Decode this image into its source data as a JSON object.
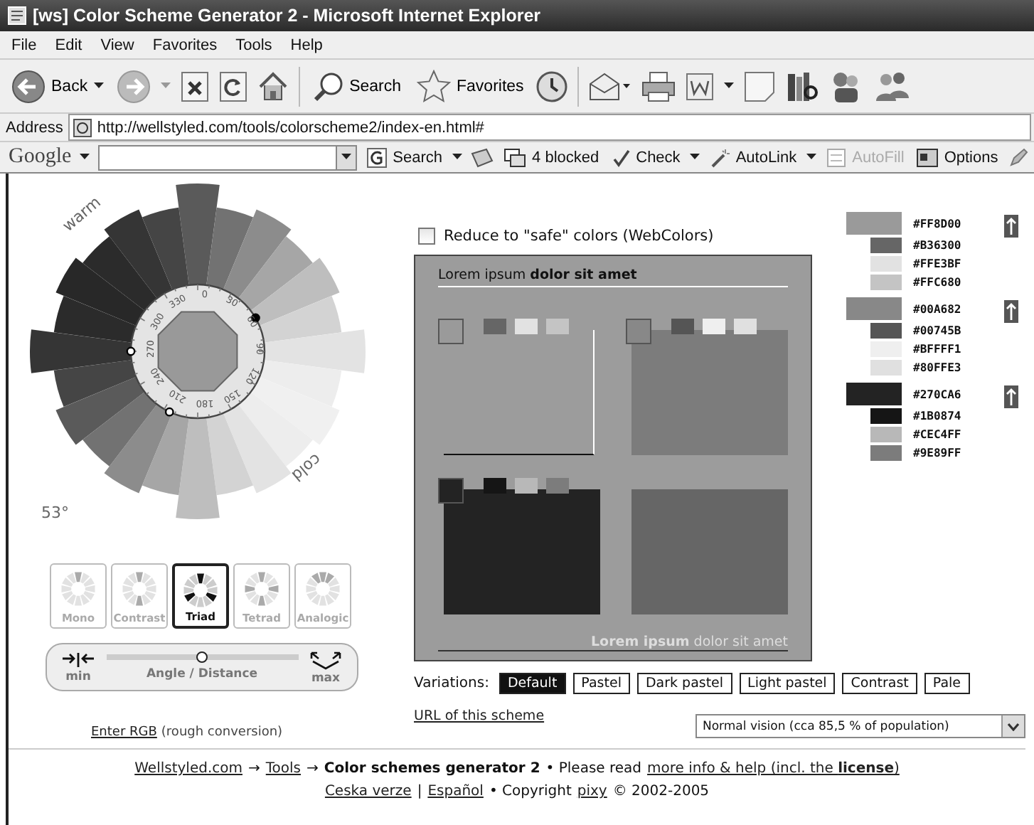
{
  "window": {
    "title": "[ws] Color Scheme Generator 2 - Microsoft Internet Explorer"
  },
  "menu": [
    "File",
    "Edit",
    "View",
    "Favorites",
    "Tools",
    "Help"
  ],
  "toolbar": {
    "back": "Back",
    "search": "Search",
    "favorites": "Favorites"
  },
  "address": {
    "label": "Address",
    "value": "http://wellstyled.com/tools/colorscheme2/index-en.html#"
  },
  "google_bar": {
    "logo": "Google",
    "search": "Search",
    "blocked": "4 blocked",
    "check": "Check",
    "autolink": "AutoLink",
    "autofill": {
      "label": "AutoFill",
      "disabled": true
    },
    "options": "Options"
  },
  "wheel": {
    "warm": "warm",
    "cold": "cold",
    "angle": "53°",
    "dial_labels": [
      "0",
      "30",
      "60",
      "90",
      "120",
      "150",
      "180",
      "210",
      "240",
      "270",
      "300",
      "330"
    ]
  },
  "schemes": [
    {
      "label": "Mono",
      "selected": false
    },
    {
      "label": "Contrast",
      "selected": false
    },
    {
      "label": "Triad",
      "selected": true
    },
    {
      "label": "Tetrad",
      "selected": false
    },
    {
      "label": "Analogic",
      "selected": false
    }
  ],
  "slider": {
    "min": "min",
    "label": "Angle / Distance",
    "max": "max",
    "level": 0.5
  },
  "enter_rgb": {
    "link": "Enter RGB",
    "note": "(rough conversion)"
  },
  "safe_colors": {
    "label": "Reduce to \"safe\" colors (WebColors)",
    "checked": false
  },
  "preview": {
    "header": "Lorem ipsum **dolor sit amet**",
    "footer": "**Lorem ipsum** dolor sit amet"
  },
  "palettes": [
    {
      "colors": [
        {
          "hex": "#FF8D00",
          "color": "#9a9a9a"
        },
        {
          "hex": "#B36300",
          "color": "#666666"
        },
        {
          "hex": "#FFE3BF",
          "color": "#e2e2e2"
        },
        {
          "hex": "#FFC680",
          "color": "#c4c4c4"
        }
      ]
    },
    {
      "colors": [
        {
          "hex": "#00A682",
          "color": "#888888"
        },
        {
          "hex": "#00745B",
          "color": "#555555"
        },
        {
          "hex": "#BFFFF1",
          "color": "#efefef"
        },
        {
          "hex": "#80FFE3",
          "color": "#e0e0e0"
        }
      ]
    },
    {
      "colors": [
        {
          "hex": "#270CA6",
          "color": "#232323"
        },
        {
          "hex": "#1B0874",
          "color": "#151515"
        },
        {
          "hex": "#CEC4FF",
          "color": "#b8b8b8"
        },
        {
          "hex": "#9E89FF",
          "color": "#7c7c7c"
        }
      ]
    }
  ],
  "variations": {
    "label": "Variations:",
    "items": [
      {
        "label": "Default",
        "selected": true
      },
      {
        "label": "Pastel",
        "selected": false
      },
      {
        "label": "Dark pastel",
        "selected": false
      },
      {
        "label": "Light pastel",
        "selected": false
      },
      {
        "label": "Contrast",
        "selected": false
      },
      {
        "label": "Pale",
        "selected": false
      }
    ]
  },
  "url_link": "URL of this scheme",
  "vision_select": "Normal vision (cca 85,5 % of population)",
  "footer": [
    [
      {
        "kind": "link",
        "text": "Wellstyled.com"
      },
      {
        "kind": "text",
        "text": "→"
      },
      {
        "kind": "link",
        "text": "Tools"
      },
      {
        "kind": "text",
        "text": "→"
      },
      {
        "kind": "bold",
        "text": "Color schemes generator 2"
      },
      {
        "kind": "text",
        "text": "• Please read"
      },
      {
        "kind": "link",
        "text": "more info & help (incl. the **license**)"
      }
    ],
    [
      {
        "kind": "link",
        "text": "Ceska verze"
      },
      {
        "kind": "text",
        "text": "|"
      },
      {
        "kind": "link",
        "text": "Español"
      },
      {
        "kind": "text",
        "text": "• Copyright"
      },
      {
        "kind": "link",
        "text": "pixy"
      },
      {
        "kind": "text",
        "text": "© 2002-2005"
      }
    ]
  ]
}
